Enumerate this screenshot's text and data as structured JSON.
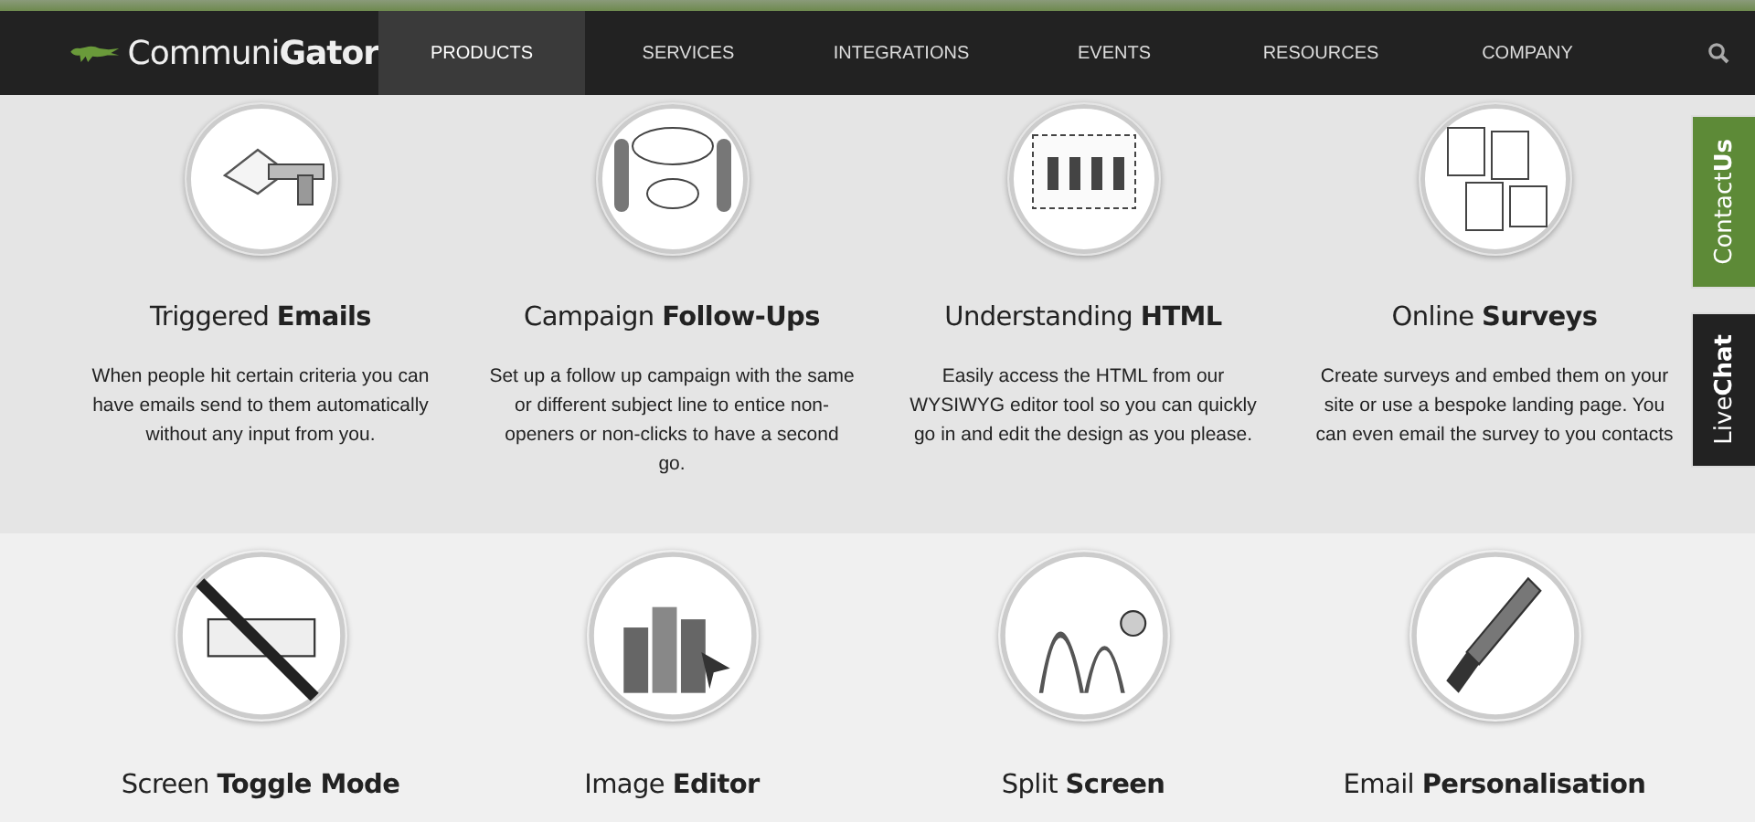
{
  "header": {
    "logo": "Communi**Gator**",
    "nav": [
      {
        "label": "PRODUCTS",
        "selected": true
      },
      {
        "label": "SERVICES",
        "selected": false
      },
      {
        "label": "INTEGRATIONS",
        "selected": false
      },
      {
        "label": "EVENTS",
        "selected": false
      },
      {
        "label": "RESOURCES",
        "selected": false
      },
      {
        "label": "COMPANY",
        "selected": false
      }
    ]
  },
  "sections": [
    {
      "features": [
        {
          "heading": "Triggered **Emails**",
          "description": "When people hit certain criteria you can have emails send to them automatically without any input from you."
        },
        {
          "heading": "Campaign **Follow-Ups**",
          "description": "Set up a follow up campaign with the same or different subject line to entice non-openers or non-clicks to have a second go."
        },
        {
          "heading": "Understanding **HTML**",
          "description": "Easily access the HTML from our WYSIWYG editor tool so you can quickly go in and edit the design as you please."
        },
        {
          "heading": "Online **Surveys**",
          "description": "Create surveys and embed them on your site or use a bespoke landing page. You can even email the survey to you contacts"
        }
      ]
    },
    {
      "features": [
        {
          "heading": "Screen **Toggle Mode**"
        },
        {
          "heading": "Image **Editor**"
        },
        {
          "heading": "Split **Screen**"
        },
        {
          "heading": "Email **Personalisation**"
        }
      ]
    }
  ],
  "side_tabs": [
    {
      "label": "Contact**Us**",
      "kind": "contact"
    },
    {
      "label": "Live**Chat**",
      "kind": "chat"
    }
  ]
}
